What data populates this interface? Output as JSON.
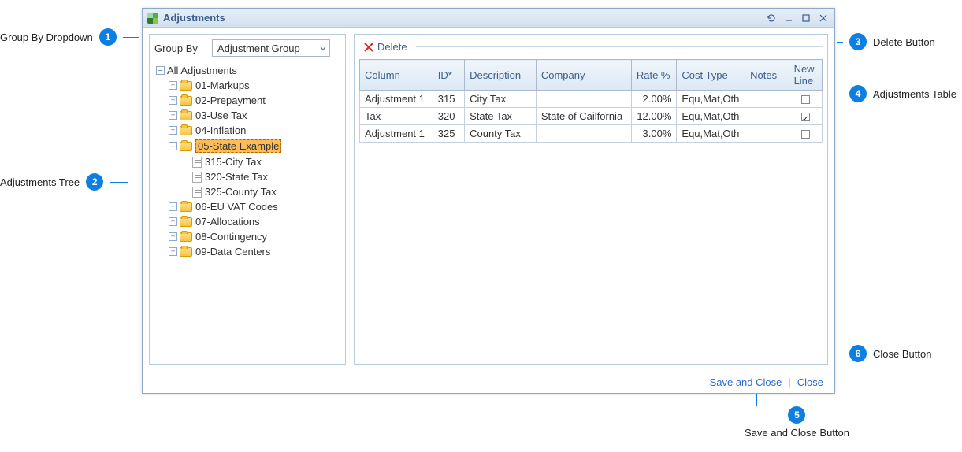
{
  "window": {
    "title": "Adjustments"
  },
  "tree": {
    "group_by_label": "Group By",
    "dropdown_value": "Adjustment Group",
    "root_label": "All Adjustments",
    "folders": [
      {
        "label": "01-Markups"
      },
      {
        "label": "02-Prepayment"
      },
      {
        "label": "03-Use Tax"
      },
      {
        "label": "04-Inflation"
      },
      {
        "label": "05-State Example",
        "expanded": true,
        "children": [
          {
            "label": "315-City Tax"
          },
          {
            "label": "320-State Tax"
          },
          {
            "label": "325-County Tax"
          }
        ]
      },
      {
        "label": "06-EU VAT Codes"
      },
      {
        "label": "07-Allocations"
      },
      {
        "label": "08-Contingency"
      },
      {
        "label": "09-Data Centers"
      }
    ]
  },
  "table": {
    "delete_label": "Delete",
    "headers": {
      "column": "Column",
      "id": "ID*",
      "description": "Description",
      "company": "Company",
      "rate": "Rate %",
      "cost_type": "Cost Type",
      "notes": "Notes",
      "new_line": "New Line"
    },
    "rows": [
      {
        "column": "Adjustment 1",
        "id": "315",
        "description": "City Tax",
        "company": "",
        "rate": "2.00%",
        "cost_type": "Equ,Mat,Oth",
        "notes": "",
        "new_line": false
      },
      {
        "column": "Tax",
        "id": "320",
        "description": "State Tax",
        "company": "State of Cailfornia",
        "rate": "12.00%",
        "cost_type": "Equ,Mat,Oth",
        "notes": "",
        "new_line": true
      },
      {
        "column": "Adjustment 1",
        "id": "325",
        "description": "County Tax",
        "company": "",
        "rate": "3.00%",
        "cost_type": "Equ,Mat,Oth",
        "notes": "",
        "new_line": false
      }
    ]
  },
  "footer": {
    "save_and_close": "Save and Close",
    "close": "Close"
  },
  "callouts": {
    "c1": "Group By Dropdown",
    "c2": "Adjustments Tree",
    "c3": "Delete Button",
    "c4": "Adjustments Table",
    "c5": "Save and Close Button",
    "c6": "Close Button"
  }
}
